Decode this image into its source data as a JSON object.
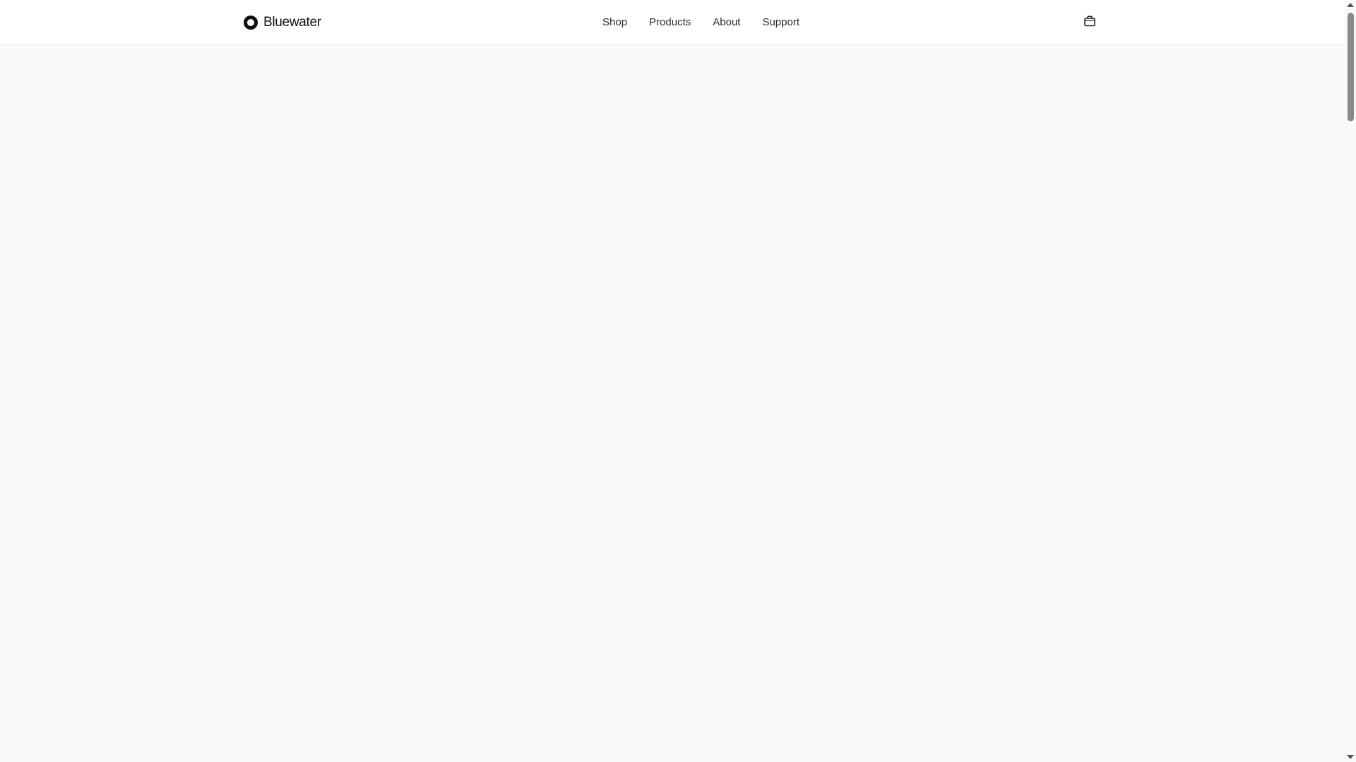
{
  "header": {
    "brand": "Bluewater",
    "nav": [
      {
        "label": "Shop"
      },
      {
        "label": "Products"
      },
      {
        "label": "About"
      },
      {
        "label": "Support"
      }
    ],
    "cart_icon": "shopping-bag-icon"
  },
  "colors": {
    "header_bg": "#ffffff",
    "page_bg": "#f8f9fa",
    "text": "#1a1a1a",
    "border": "#e3e5e8"
  }
}
